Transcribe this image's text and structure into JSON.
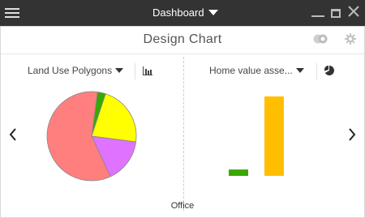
{
  "window": {
    "title": "Dashboard",
    "menu_icon": "hamburger-icon",
    "controls": [
      "minimize-icon",
      "maximize-icon",
      "close-icon"
    ]
  },
  "widget": {
    "title": "Design Chart",
    "toggle_icon": "toggle-chart-icon",
    "settings_icon": "gear-icon"
  },
  "left_panel": {
    "layer_label": "Land Use Polygons",
    "chart_type_icon": "bar-chart-icon"
  },
  "right_panel": {
    "layer_label": "Home value asse...",
    "chart_type_icon": "pie-chart-icon"
  },
  "navigation": {
    "prev_icon": "chevron-left-icon",
    "next_icon": "chevron-right-icon"
  },
  "footer": {
    "category_label": "Office"
  },
  "colors": {
    "titlebar": "#333333",
    "pie_red": "#ff7f7f",
    "pie_yellow": "#ffff00",
    "pie_purple": "#df73ff",
    "pie_green": "#38a800",
    "bar_green": "#38a800",
    "bar_orange": "#ffbf00"
  },
  "chart_data": [
    {
      "type": "pie",
      "slices": [
        {
          "value": 3,
          "color": "#38a800"
        },
        {
          "value": 22,
          "color": "#ffff00"
        },
        {
          "value": 16,
          "color": "#df73ff"
        },
        {
          "value": 59,
          "color": "#ff7f7f"
        }
      ]
    },
    {
      "type": "bar",
      "values": [
        8,
        100
      ],
      "colors": [
        "#38a800",
        "#ffbf00"
      ],
      "ylim": [
        0,
        100
      ]
    }
  ]
}
